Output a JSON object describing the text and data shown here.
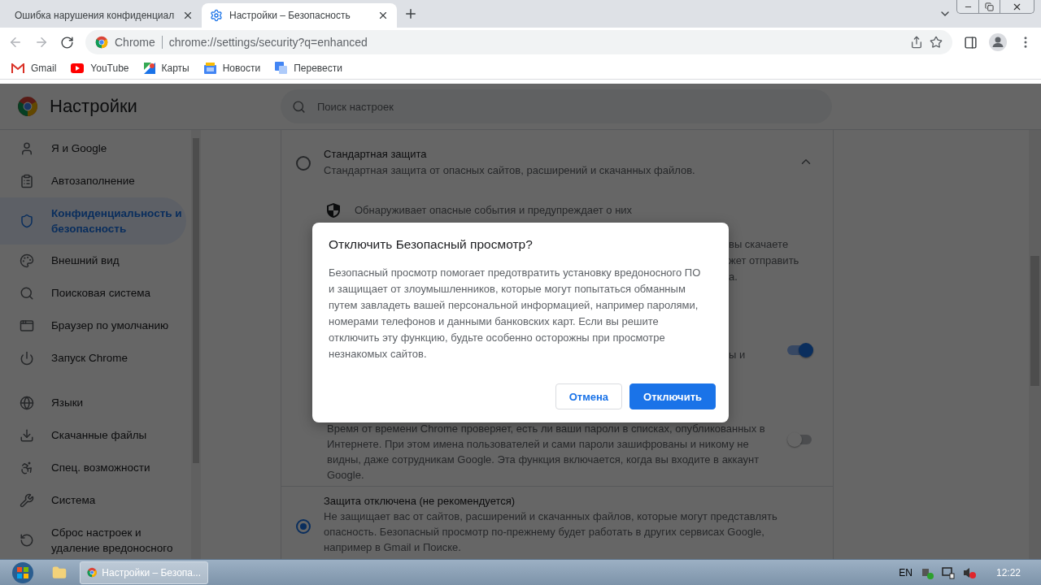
{
  "browser": {
    "tabs": [
      {
        "title": "Ошибка нарушения конфиденциал",
        "selected": false
      },
      {
        "title": "Настройки – Безопасность",
        "selected": true
      }
    ],
    "address": {
      "site_label": "Chrome",
      "url": "chrome://settings/security?q=enhanced"
    },
    "bookmarks": [
      {
        "label": "Gmail"
      },
      {
        "label": "YouTube"
      },
      {
        "label": "Карты"
      },
      {
        "label": "Новости"
      },
      {
        "label": "Перевести"
      }
    ]
  },
  "settings": {
    "title": "Настройки",
    "search": {
      "placeholder": "Поиск настроек"
    },
    "sidebar": {
      "groups": [
        [
          {
            "label": "Я и Google",
            "selected": false
          },
          {
            "label": "Автозаполнение",
            "selected": false
          },
          {
            "label": "Конфиденциальность и безопасность",
            "selected": true
          },
          {
            "label": "Внешний вид",
            "selected": false
          },
          {
            "label": "Поисковая система",
            "selected": false
          },
          {
            "label": "Браузер по умолчанию",
            "selected": false
          },
          {
            "label": "Запуск Chrome",
            "selected": false
          }
        ],
        [
          {
            "label": "Языки",
            "selected": false
          },
          {
            "label": "Скачанные файлы",
            "selected": false
          },
          {
            "label": "Спец. возможности",
            "selected": false
          },
          {
            "label": "Система",
            "selected": false
          },
          {
            "label": "Сброс настроек и удаление вредоносного",
            "selected": false
          }
        ]
      ]
    },
    "content": {
      "standard": {
        "title": "Стандартная защита",
        "description": "Стандартная защита от опасных сайтов, расширений и скачанных файлов.",
        "selected": false,
        "expanded": true
      },
      "bullet": "Обнаруживает опасные события и предупреждает о них",
      "fragments": [
        "вы скачаете",
        "жет отправить",
        "а."
      ],
      "toggle_row": {
        "fragment": "ы и",
        "on": true
      },
      "password_row": {
        "description": "Время от времени Chrome проверяет, есть ли ваши пароли в списках, опубликованных в Интернете. При этом имена пользователей и сами пароли зашифрованы и никому не видны, даже сотрудникам Google. Эта функция включается, когда вы входите в аккаунт Google.",
        "on": false
      },
      "no_protection": {
        "title": "Защита отключена (не рекомендуется)",
        "description": "Не защищает вас от сайтов, расширений и скачанных файлов, которые могут представлять опасность. Безопасный просмотр по-прежнему будет работать в других сервисах Google, например в Gmail и Поиске.",
        "selected": true
      }
    }
  },
  "dialog": {
    "title": "Отключить Безопасный просмотр?",
    "body": "Безопасный просмотр помогает предотвратить установку вредоносного ПО и защищает от злоумышленников, которые могут попытаться обманным путем завладеть вашей персональной информацией, например паролями, номерами телефонов и данными банковских карт. Если вы решите отключить эту функцию, будьте особенно осторожны при просмотре незнакомых сайтов.",
    "buttons": [
      {
        "label": "Отмена",
        "kind": "secondary"
      },
      {
        "label": "Отключить",
        "kind": "primary"
      }
    ]
  },
  "taskbar": {
    "windows": [
      {
        "label": "Настройки – Безопа...",
        "selected": true
      }
    ],
    "language": "EN",
    "clock": "12:22"
  }
}
